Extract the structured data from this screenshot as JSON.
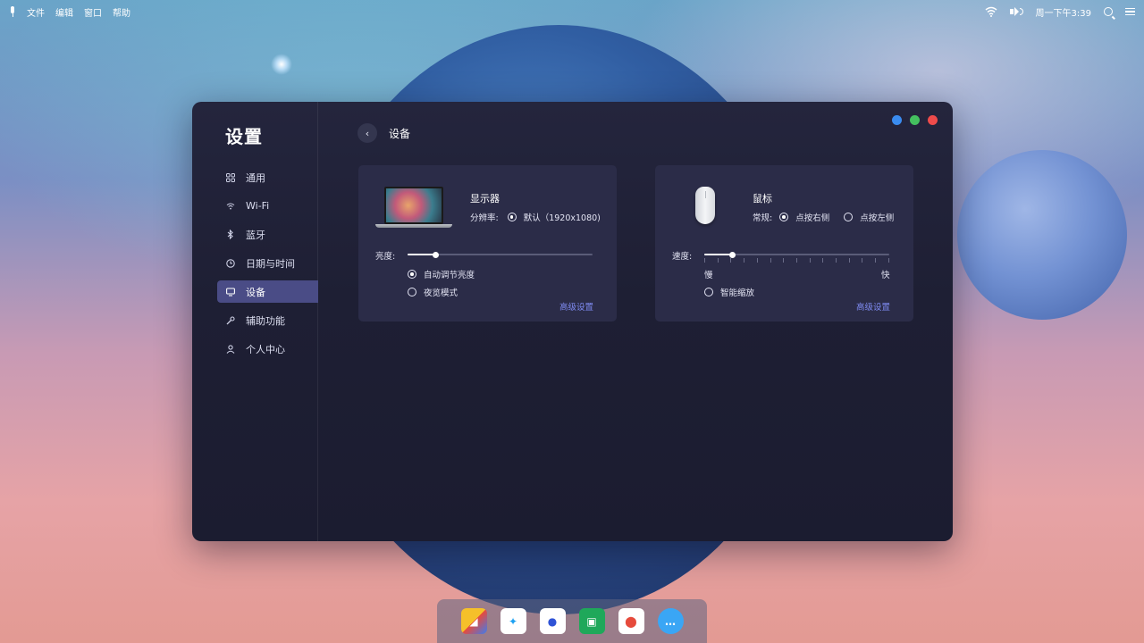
{
  "menubar": {
    "items": [
      "文件",
      "编辑",
      "窗口",
      "帮助"
    ],
    "clock": "周一下午3:39"
  },
  "window": {
    "sidebar_title": "设置",
    "nav": [
      {
        "label": "通用",
        "icon": "grid-icon"
      },
      {
        "label": "Wi-Fi",
        "icon": "wifi-icon"
      },
      {
        "label": "蓝牙",
        "icon": "bluetooth-icon"
      },
      {
        "label": "日期与时间",
        "icon": "clock-icon"
      },
      {
        "label": "设备",
        "icon": "monitor-icon",
        "active": true
      },
      {
        "label": "辅助功能",
        "icon": "wrench-icon"
      },
      {
        "label": "个人中心",
        "icon": "user-icon"
      }
    ],
    "header_title": "设备",
    "display_card": {
      "name": "显示器",
      "resolution_label": "分辨率:",
      "resolution_value": "默认（1920x1080)",
      "brightness_label": "亮度:",
      "brightness_level": 0.15,
      "auto_brightness": "自动调节亮度",
      "night_mode": "夜览模式",
      "advanced": "高级设置"
    },
    "mouse_card": {
      "name": "鼠标",
      "general_label": "常规:",
      "right_click": "点按右侧",
      "left_click": "点按左侧",
      "speed_label": "速度:",
      "speed_level": 0.15,
      "slow": "慢",
      "fast": "快",
      "smart_zoom": "智能缩放",
      "advanced": "高级设置"
    }
  },
  "colors": {
    "accent": "#4a4c86",
    "link": "#7e8af0",
    "window_bg": "#1e1f34",
    "card_bg": "#2b2c48"
  }
}
